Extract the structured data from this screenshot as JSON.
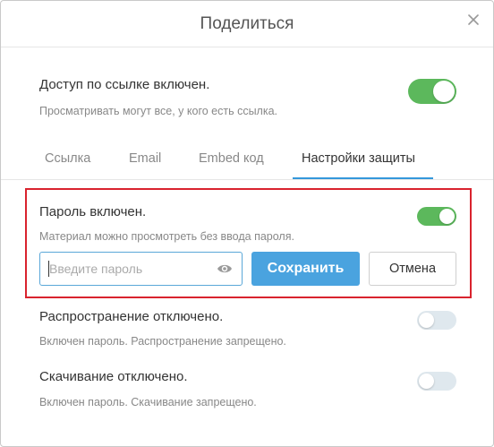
{
  "dialog": {
    "title": "Поделиться"
  },
  "access": {
    "title": "Доступ по ссылке включен.",
    "description": "Просматривать могут все, у кого есть ссылка.",
    "enabled": true
  },
  "tabs": [
    {
      "label": "Ссылка",
      "active": false
    },
    {
      "label": "Email",
      "active": false
    },
    {
      "label": "Embed код",
      "active": false
    },
    {
      "label": "Настройки защиты",
      "active": true
    }
  ],
  "password": {
    "title": "Пароль включен.",
    "description": "Материал можно просмотреть без ввода пароля.",
    "enabled": true,
    "input_value": "",
    "input_placeholder": "Введите пароль",
    "save_label": "Сохранить",
    "cancel_label": "Отмена"
  },
  "sharing": {
    "title": "Распространение отключено.",
    "description": "Включен пароль. Распространение запрещено.",
    "enabled": false
  },
  "download": {
    "title": "Скачивание отключено.",
    "description": "Включен пароль. Скачивание запрещено.",
    "enabled": false
  },
  "colors": {
    "toggle_on": "#5cb85c",
    "toggle_off": "#dfe8ee",
    "accent": "#4aa3df",
    "tab_underline": "#3498db",
    "highlight_border": "#d9232e"
  },
  "icons": {
    "close": "close-icon",
    "eye": "eye-icon"
  }
}
